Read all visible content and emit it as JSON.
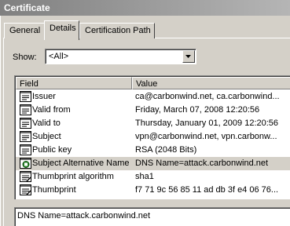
{
  "window": {
    "title": "Certificate"
  },
  "tabs": [
    {
      "label": "General",
      "active": false
    },
    {
      "label": "Details",
      "active": true
    },
    {
      "label": "Certification Path",
      "active": false
    }
  ],
  "show": {
    "label": "Show:",
    "value": "<All>"
  },
  "list": {
    "columns": [
      "Field",
      "Value"
    ],
    "rows": [
      {
        "field": "Issuer",
        "value": "ca@carbonwind.net, ca.carbonwind...",
        "icon": "certificate-field-icon",
        "selected": false
      },
      {
        "field": "Valid from",
        "value": "Friday, March 07, 2008 12:20:56",
        "icon": "certificate-field-icon",
        "selected": false
      },
      {
        "field": "Valid to",
        "value": "Thursday, January 01, 2009 12:20:56",
        "icon": "certificate-field-icon",
        "selected": false
      },
      {
        "field": "Subject",
        "value": "vpn@carbonwind.net, vpn.carbonw...",
        "icon": "certificate-field-icon",
        "selected": false
      },
      {
        "field": "Public key",
        "value": "RSA (2048 Bits)",
        "icon": "certificate-field-icon",
        "selected": false
      },
      {
        "field": "Subject Alternative Name",
        "value": "DNS Name=attack.carbonwind.net",
        "icon": "extension-icon",
        "selected": true
      },
      {
        "field": "Thumbprint algorithm",
        "value": "sha1",
        "icon": "property-icon",
        "selected": false
      },
      {
        "field": "Thumbprint",
        "value": "f7 71 9c 56 85 11 ad db 3f e4 06 76...",
        "icon": "property-icon",
        "selected": false
      }
    ]
  },
  "details_text": "DNS Name=attack.carbonwind.net",
  "colors": {
    "title_bar_start": "#808080",
    "title_bar_end": "#b5b5b5",
    "dialog_face": "#d4d0c8",
    "list_background": "#ffffff",
    "selected_row": "#d4d0c8"
  }
}
